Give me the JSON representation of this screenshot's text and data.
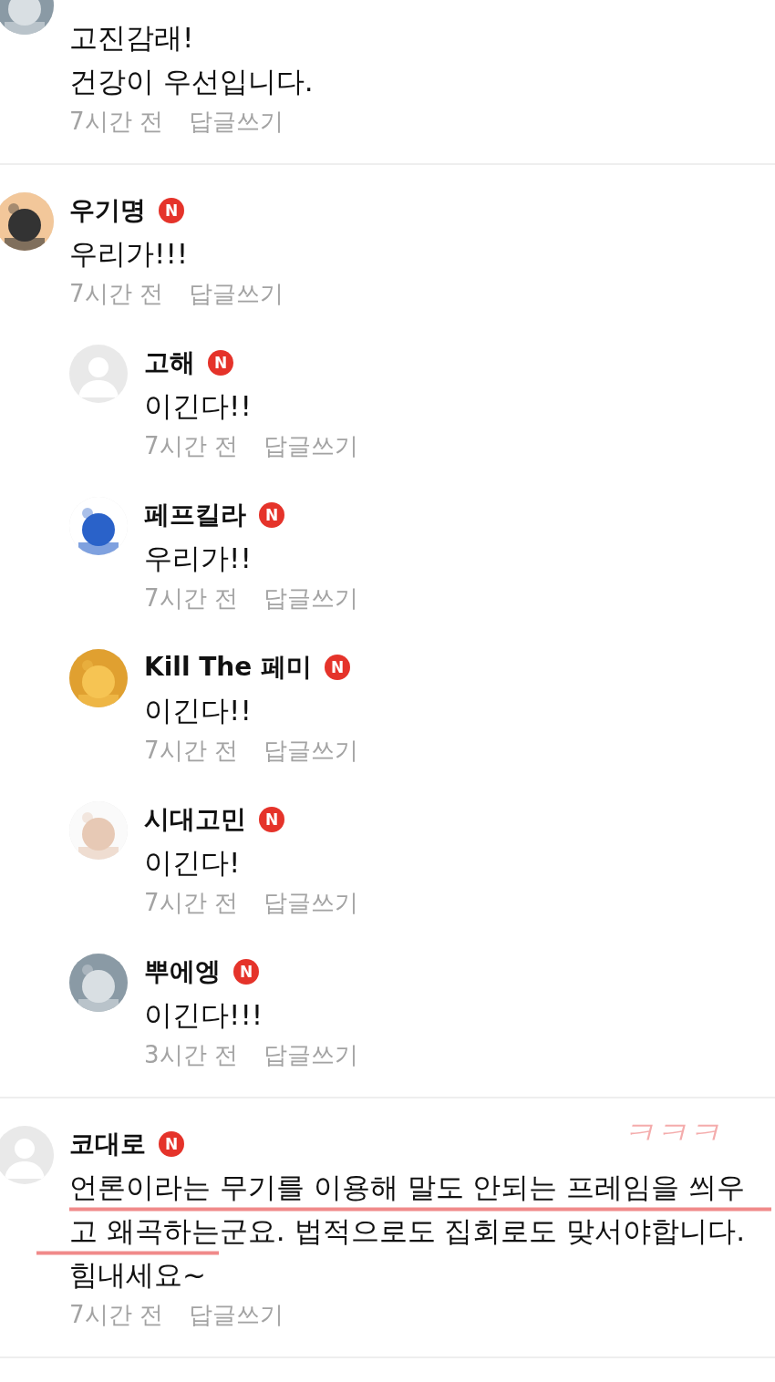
{
  "comments": [
    {
      "avatar": {
        "kind": "picture"
      },
      "body": [
        "고진감래!",
        "건강이 우선입니다."
      ],
      "time": "7시간 전",
      "reply": "답글쓰기"
    },
    {
      "avatar": {
        "kind": "picture"
      },
      "name": "우기명",
      "badge": "N",
      "body": [
        "우리가!!!"
      ],
      "time": "7시간 전",
      "reply": "답글쓰기",
      "replies": [
        {
          "avatar": {
            "kind": "default"
          },
          "name": "고해",
          "badge": "N",
          "body": [
            "이긴다!!"
          ],
          "time": "7시간 전",
          "reply": "답글쓰기"
        },
        {
          "avatar": {
            "kind": "picture"
          },
          "name": "페프킬라",
          "badge": "N",
          "body": [
            "우리가!!"
          ],
          "time": "7시간 전",
          "reply": "답글쓰기"
        },
        {
          "avatar": {
            "kind": "picture"
          },
          "name": "Kill The 페미",
          "badge": "N",
          "body": [
            "이긴다!!"
          ],
          "time": "7시간 전",
          "reply": "답글쓰기"
        },
        {
          "avatar": {
            "kind": "picture"
          },
          "name": "시대고민",
          "badge": "N",
          "body": [
            "이긴다!"
          ],
          "time": "7시간 전",
          "reply": "답글쓰기"
        },
        {
          "avatar": {
            "kind": "picture"
          },
          "name": "뿌에엥",
          "badge": "N",
          "body": [
            "이긴다!!!"
          ],
          "time": "3시간 전",
          "reply": "답글쓰기"
        }
      ]
    },
    {
      "avatar": {
        "kind": "default"
      },
      "name": "코대로",
      "badge": "N",
      "body": [
        "언론이라는 무기를 이용해 말도 안되는 프레임을 씌우",
        "고 왜곡하는군요. 법적으로도 집회로도 맞서야합니다.",
        "힘내세요~"
      ],
      "time": "7시간 전",
      "reply": "답글쓰기",
      "annotation": "ㅋㅋㅋ"
    }
  ]
}
